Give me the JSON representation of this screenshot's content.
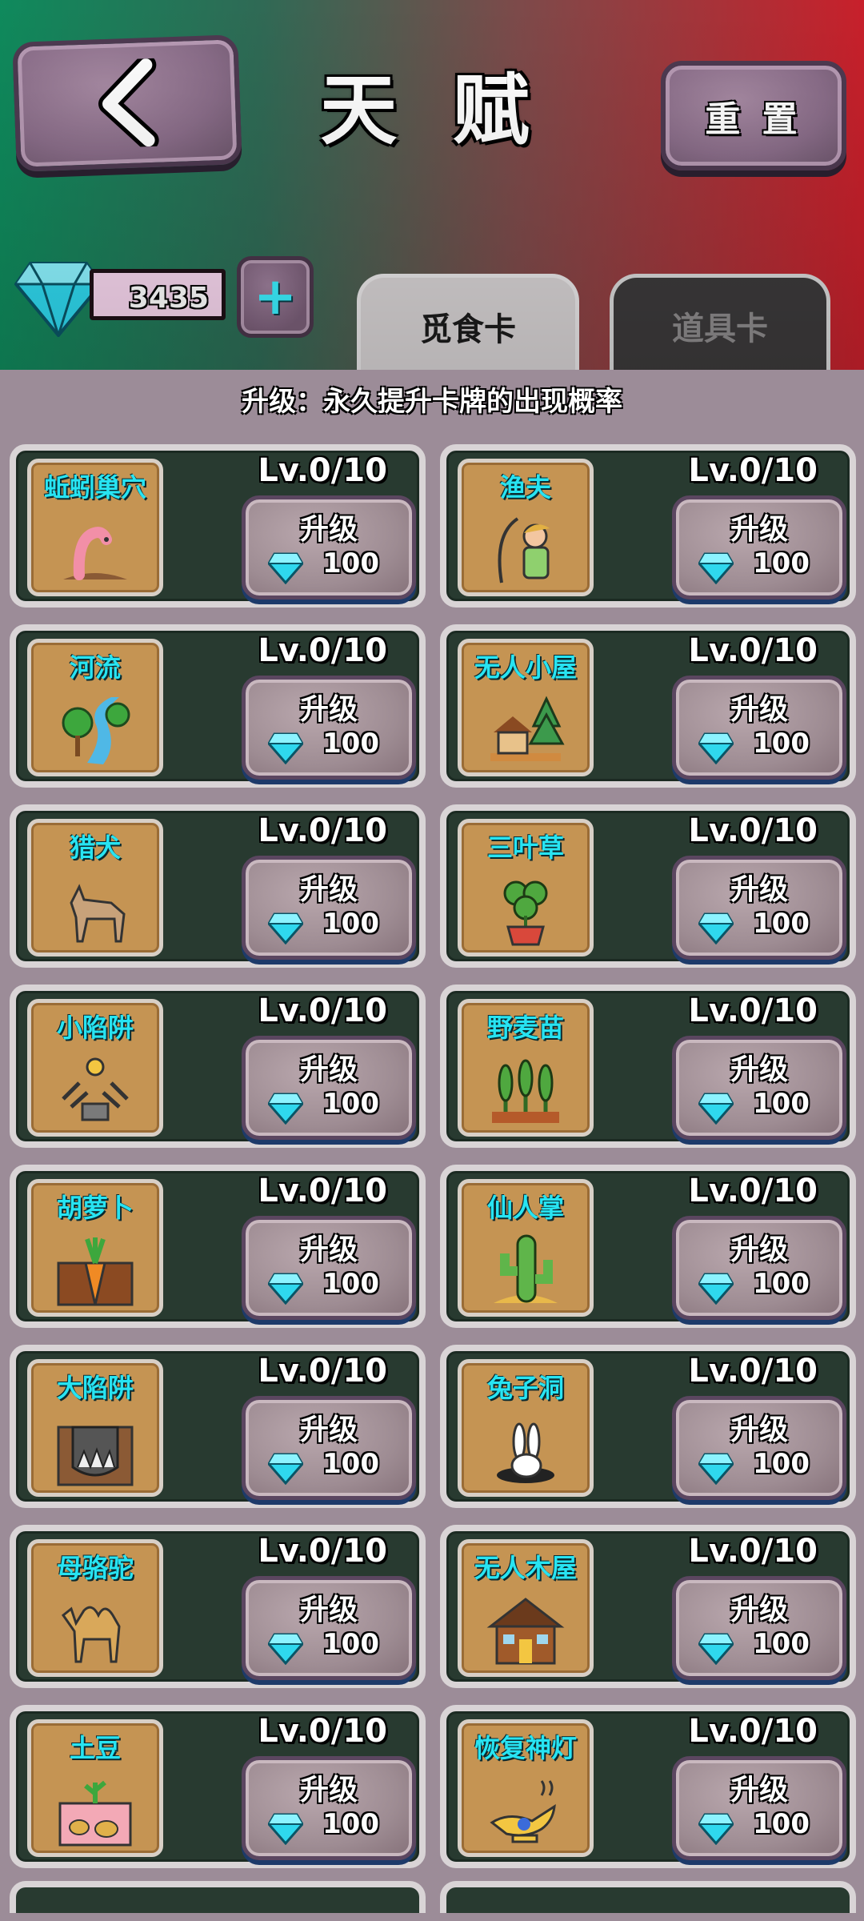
{
  "header": {
    "title": "天 赋",
    "reset_label": "重 置"
  },
  "currency": {
    "gems": "3435",
    "add_symbol": "+"
  },
  "tabs": [
    {
      "label": "觅食卡",
      "active": true
    },
    {
      "label": "道具卡",
      "active": false
    }
  ],
  "subtitle": "升级：永久提升卡牌的出现概率",
  "upgrade_label": "升级",
  "colors": {
    "accent_cyan": "#27e4f2",
    "card_bg": "#283a30",
    "icon_bg": "#c59453"
  },
  "cards": [
    {
      "name": "蚯蚓巢穴",
      "level": "Lv.0/10",
      "cost": "100",
      "icon": "worm-icon"
    },
    {
      "name": "渔夫",
      "level": "Lv.0/10",
      "cost": "100",
      "icon": "fisherman-icon"
    },
    {
      "name": "河流",
      "level": "Lv.0/10",
      "cost": "100",
      "icon": "river-icon"
    },
    {
      "name": "无人小屋",
      "level": "Lv.0/10",
      "cost": "100",
      "icon": "small-hut-icon"
    },
    {
      "name": "猎犬",
      "level": "Lv.0/10",
      "cost": "100",
      "icon": "hound-icon"
    },
    {
      "name": "三叶草",
      "level": "Lv.0/10",
      "cost": "100",
      "icon": "clover-icon"
    },
    {
      "name": "小陷阱",
      "level": "Lv.0/10",
      "cost": "100",
      "icon": "small-trap-icon"
    },
    {
      "name": "野麦苗",
      "level": "Lv.0/10",
      "cost": "100",
      "icon": "wheat-icon"
    },
    {
      "name": "胡萝卜",
      "level": "Lv.0/10",
      "cost": "100",
      "icon": "carrot-icon"
    },
    {
      "name": "仙人掌",
      "level": "Lv.0/10",
      "cost": "100",
      "icon": "cactus-icon"
    },
    {
      "name": "大陷阱",
      "level": "Lv.0/10",
      "cost": "100",
      "icon": "big-trap-icon"
    },
    {
      "name": "兔子洞",
      "level": "Lv.0/10",
      "cost": "100",
      "icon": "rabbit-hole-icon"
    },
    {
      "name": "母骆驼",
      "level": "Lv.0/10",
      "cost": "100",
      "icon": "camel-icon"
    },
    {
      "name": "无人木屋",
      "level": "Lv.0/10",
      "cost": "100",
      "icon": "log-cabin-icon"
    },
    {
      "name": "土豆",
      "level": "Lv.0/10",
      "cost": "100",
      "icon": "potato-icon"
    },
    {
      "name": "恢复神灯",
      "level": "Lv.0/10",
      "cost": "100",
      "icon": "magic-lamp-icon"
    }
  ]
}
